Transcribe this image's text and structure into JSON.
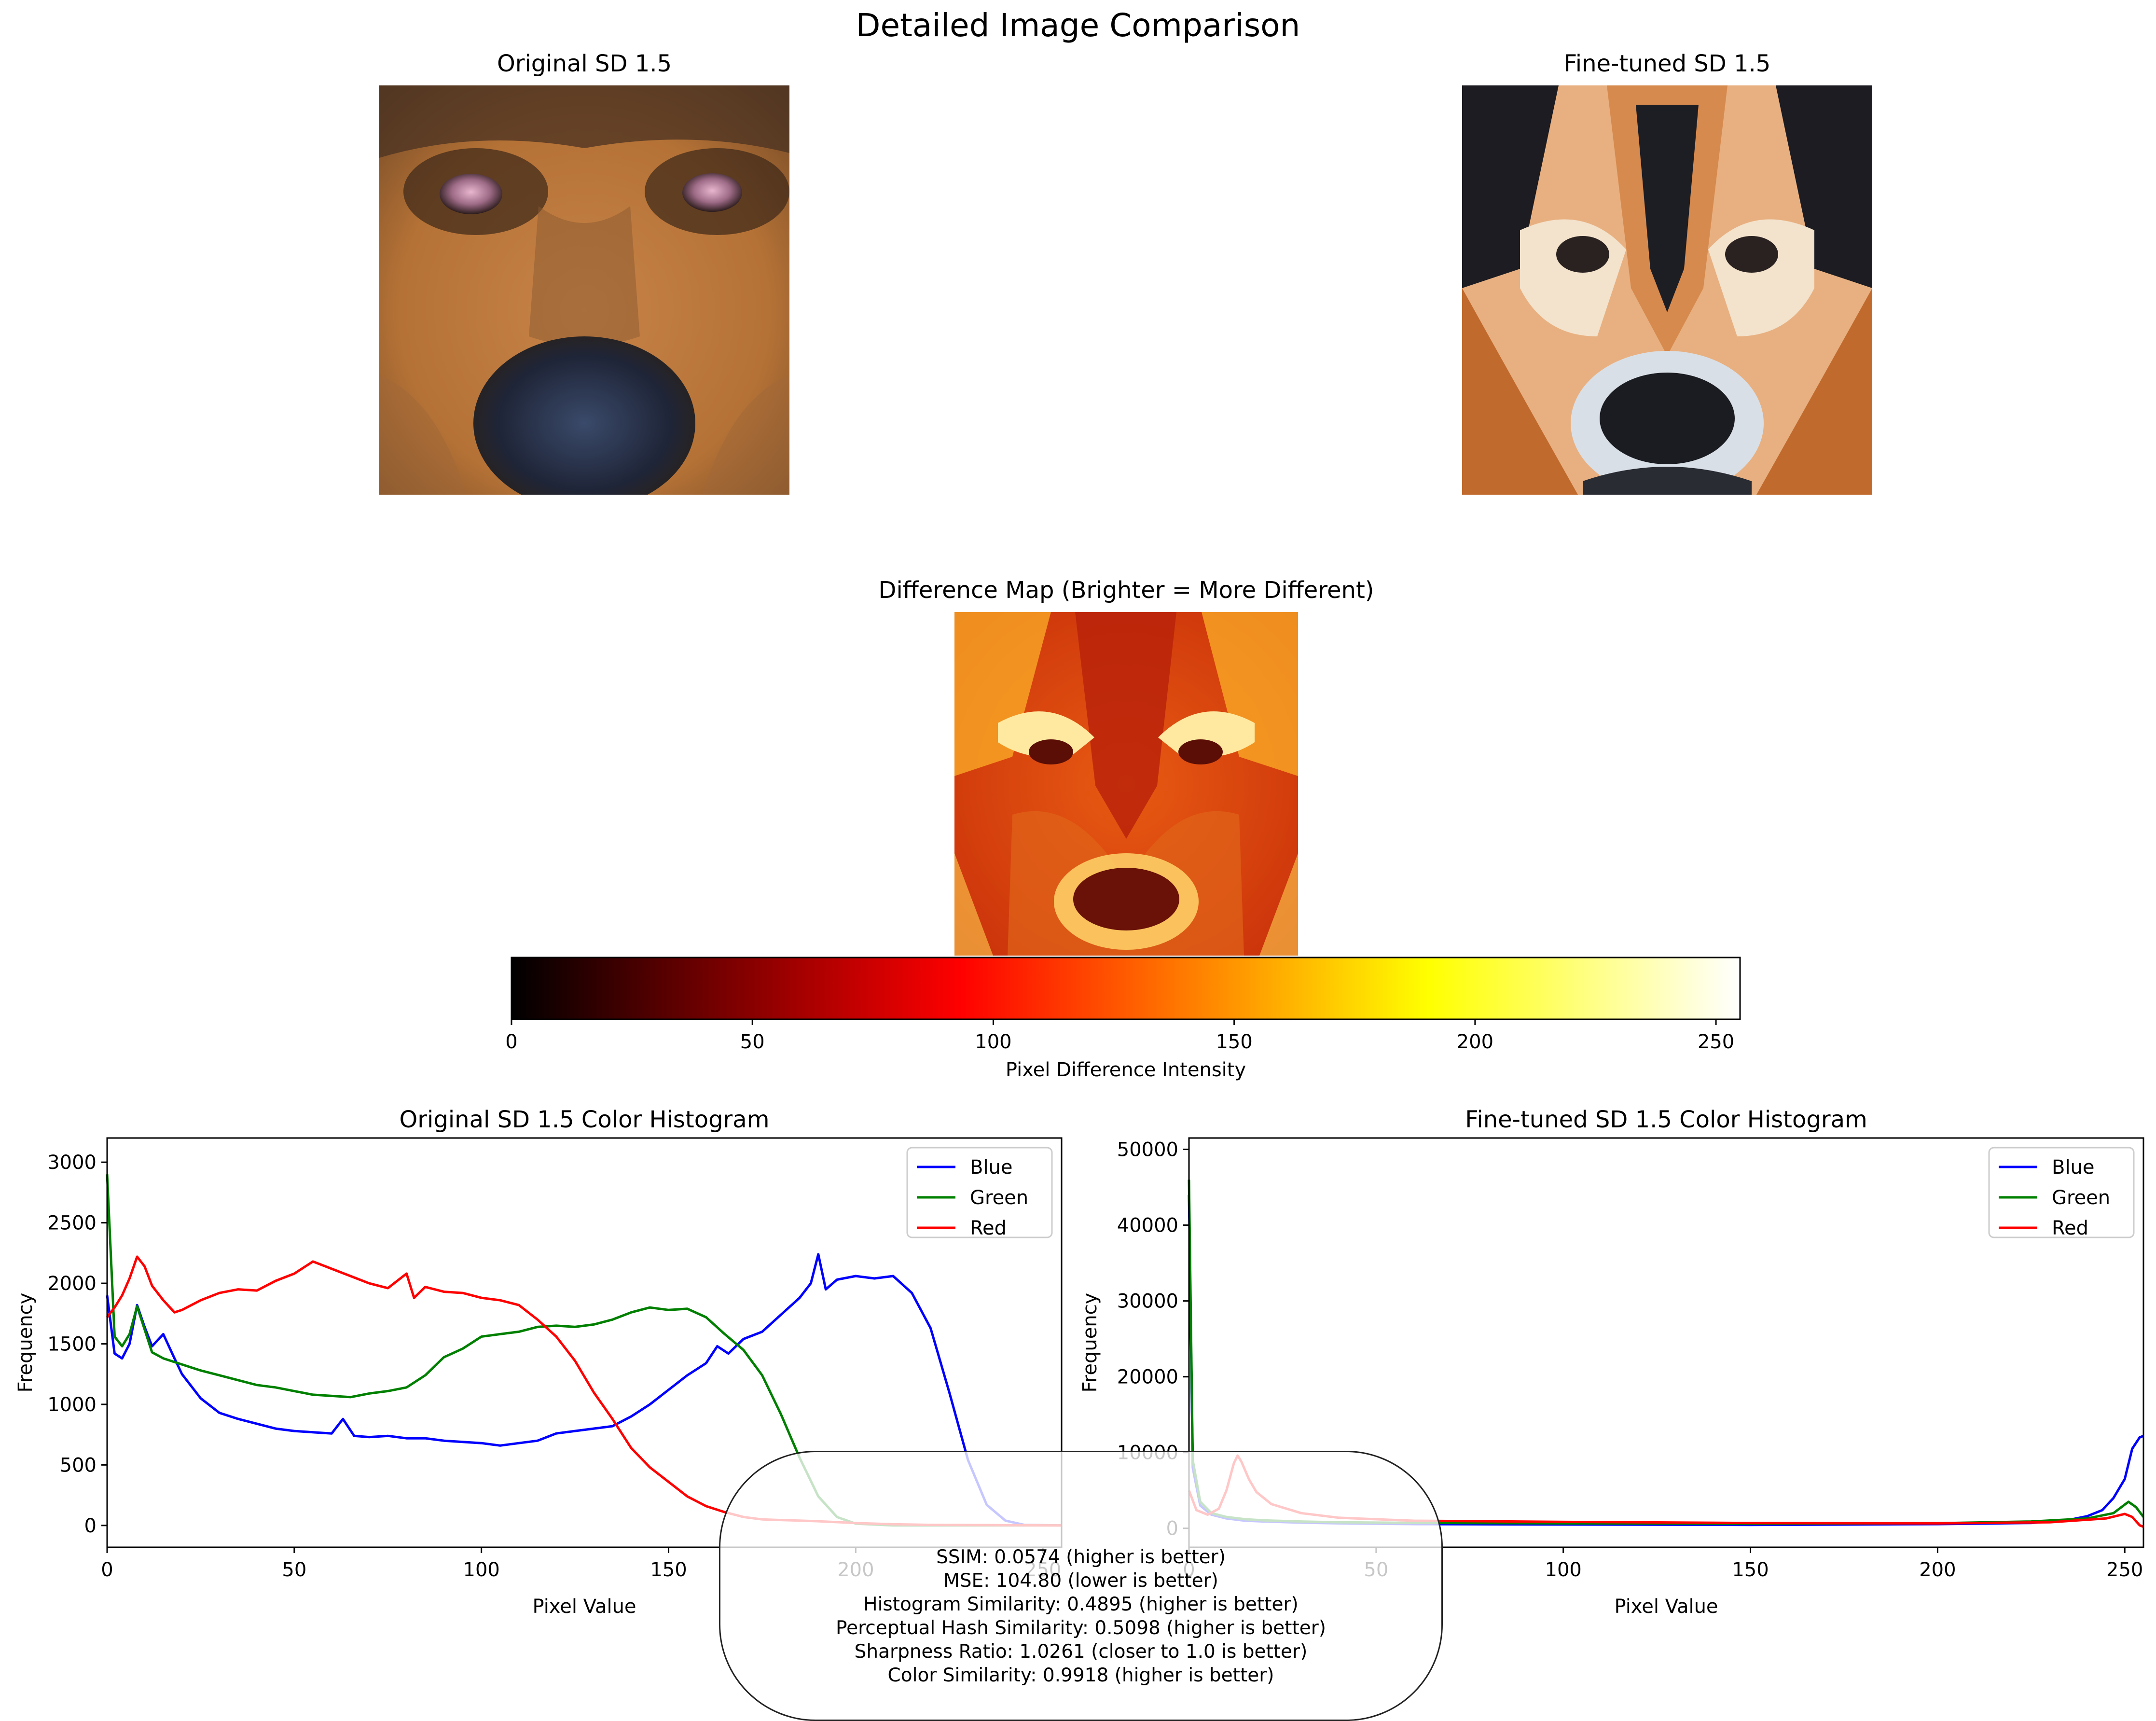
{
  "figure": {
    "title": "Detailed Image Comparison",
    "panel_original_title": "Original SD 1.5",
    "panel_finetuned_title": "Fine-tuned SD 1.5",
    "panel_diff_title": "Difference Map (Brighter = More Different)"
  },
  "images": {
    "original": {
      "depicts": "close-up of a German shepherd dog's face, photographic"
    },
    "finetuned": {
      "depicts": "stylized illustration of a dog's face with black and tan fur"
    },
    "difference": {
      "depicts": "heatmap of pixel differences in red/orange/yellow"
    }
  },
  "colorbar": {
    "label": "Pixel Difference Intensity",
    "ticks": [
      "0",
      "50",
      "100",
      "150",
      "200",
      "250"
    ],
    "range": [
      0,
      255
    ],
    "colormap": "hot",
    "colors": [
      "#000000",
      "#ff0000",
      "#ffff00",
      "#ffffff"
    ]
  },
  "metrics": [
    "SSIM: 0.0574 (higher is better)",
    "MSE: 104.80 (lower is better)",
    "Histogram Similarity: 0.4895 (higher is better)",
    "Perceptual Hash Similarity: 0.5098 (higher is better)",
    "Sharpness Ratio: 1.0261 (closer to 1.0 is better)",
    "Color Similarity: 0.9918 (higher is better)"
  ],
  "series_colors": {
    "Blue": "#0000ff",
    "Green": "#008000",
    "Red": "#ff0000"
  },
  "chart_data": [
    {
      "type": "line",
      "title": "Original SD 1.5 Color Histogram",
      "xlabel": "Pixel Value",
      "ylabel": "Frequency",
      "xlim": [
        0,
        255
      ],
      "ylim": [
        -180,
        3200
      ],
      "xticks": [
        0,
        50,
        100,
        150,
        200,
        250
      ],
      "yticks": [
        0,
        500,
        1000,
        1500,
        2000,
        2500,
        3000
      ],
      "grid": false,
      "legend": "top-right",
      "series": [
        {
          "name": "Blue",
          "points": [
            [
              0,
              1900
            ],
            [
              2,
              1420
            ],
            [
              4,
              1380
            ],
            [
              6,
              1500
            ],
            [
              8,
              1820
            ],
            [
              10,
              1640
            ],
            [
              12,
              1480
            ],
            [
              15,
              1580
            ],
            [
              18,
              1380
            ],
            [
              20,
              1250
            ],
            [
              25,
              1050
            ],
            [
              30,
              930
            ],
            [
              35,
              880
            ],
            [
              40,
              840
            ],
            [
              45,
              800
            ],
            [
              50,
              780
            ],
            [
              55,
              770
            ],
            [
              60,
              760
            ],
            [
              63,
              880
            ],
            [
              66,
              740
            ],
            [
              70,
              730
            ],
            [
              75,
              740
            ],
            [
              80,
              720
            ],
            [
              85,
              720
            ],
            [
              90,
              700
            ],
            [
              95,
              690
            ],
            [
              100,
              680
            ],
            [
              105,
              660
            ],
            [
              110,
              680
            ],
            [
              115,
              700
            ],
            [
              120,
              760
            ],
            [
              125,
              780
            ],
            [
              130,
              800
            ],
            [
              135,
              820
            ],
            [
              140,
              900
            ],
            [
              145,
              1000
            ],
            [
              150,
              1120
            ],
            [
              155,
              1240
            ],
            [
              160,
              1340
            ],
            [
              163,
              1480
            ],
            [
              166,
              1420
            ],
            [
              170,
              1540
            ],
            [
              175,
              1600
            ],
            [
              180,
              1740
            ],
            [
              185,
              1880
            ],
            [
              188,
              2000
            ],
            [
              190,
              2240
            ],
            [
              192,
              1950
            ],
            [
              195,
              2030
            ],
            [
              200,
              2060
            ],
            [
              205,
              2040
            ],
            [
              210,
              2060
            ],
            [
              215,
              1920
            ],
            [
              220,
              1630
            ],
            [
              225,
              1100
            ],
            [
              230,
              540
            ],
            [
              235,
              170
            ],
            [
              240,
              40
            ],
            [
              245,
              5
            ],
            [
              255,
              0
            ]
          ]
        },
        {
          "name": "Green",
          "points": [
            [
              0,
              2900
            ],
            [
              2,
              1560
            ],
            [
              4,
              1480
            ],
            [
              6,
              1580
            ],
            [
              8,
              1810
            ],
            [
              10,
              1620
            ],
            [
              12,
              1430
            ],
            [
              15,
              1380
            ],
            [
              20,
              1330
            ],
            [
              25,
              1280
            ],
            [
              30,
              1240
            ],
            [
              35,
              1200
            ],
            [
              40,
              1160
            ],
            [
              45,
              1140
            ],
            [
              50,
              1110
            ],
            [
              55,
              1080
            ],
            [
              60,
              1070
            ],
            [
              65,
              1060
            ],
            [
              70,
              1090
            ],
            [
              75,
              1110
            ],
            [
              80,
              1140
            ],
            [
              85,
              1240
            ],
            [
              90,
              1390
            ],
            [
              95,
              1460
            ],
            [
              100,
              1560
            ],
            [
              105,
              1580
            ],
            [
              110,
              1600
            ],
            [
              115,
              1640
            ],
            [
              120,
              1650
            ],
            [
              125,
              1640
            ],
            [
              130,
              1660
            ],
            [
              135,
              1700
            ],
            [
              140,
              1760
            ],
            [
              145,
              1800
            ],
            [
              150,
              1780
            ],
            [
              155,
              1790
            ],
            [
              160,
              1720
            ],
            [
              165,
              1580
            ],
            [
              170,
              1450
            ],
            [
              175,
              1240
            ],
            [
              180,
              920
            ],
            [
              185,
              560
            ],
            [
              190,
              240
            ],
            [
              195,
              70
            ],
            [
              200,
              15
            ],
            [
              210,
              0
            ],
            [
              255,
              0
            ]
          ]
        },
        {
          "name": "Red",
          "points": [
            [
              0,
              1720
            ],
            [
              2,
              1800
            ],
            [
              4,
              1900
            ],
            [
              6,
              2040
            ],
            [
              8,
              2220
            ],
            [
              10,
              2140
            ],
            [
              12,
              1980
            ],
            [
              15,
              1860
            ],
            [
              18,
              1760
            ],
            [
              20,
              1780
            ],
            [
              25,
              1860
            ],
            [
              30,
              1920
            ],
            [
              35,
              1950
            ],
            [
              40,
              1940
            ],
            [
              45,
              2020
            ],
            [
              50,
              2080
            ],
            [
              55,
              2180
            ],
            [
              60,
              2120
            ],
            [
              65,
              2060
            ],
            [
              70,
              2000
            ],
            [
              75,
              1960
            ],
            [
              80,
              2080
            ],
            [
              82,
              1880
            ],
            [
              85,
              1970
            ],
            [
              90,
              1930
            ],
            [
              95,
              1920
            ],
            [
              100,
              1880
            ],
            [
              105,
              1860
            ],
            [
              110,
              1820
            ],
            [
              115,
              1700
            ],
            [
              120,
              1560
            ],
            [
              125,
              1360
            ],
            [
              130,
              1100
            ],
            [
              135,
              880
            ],
            [
              140,
              640
            ],
            [
              145,
              480
            ],
            [
              150,
              360
            ],
            [
              155,
              240
            ],
            [
              160,
              160
            ],
            [
              165,
              110
            ],
            [
              170,
              70
            ],
            [
              175,
              50
            ],
            [
              180,
              45
            ],
            [
              185,
              40
            ],
            [
              190,
              35
            ],
            [
              200,
              20
            ],
            [
              210,
              10
            ],
            [
              220,
              5
            ],
            [
              255,
              0
            ]
          ]
        }
      ]
    },
    {
      "type": "line",
      "title": "Fine-tuned SD 1.5 Color Histogram",
      "xlabel": "Pixel Value",
      "ylabel": "Frequency",
      "xlim": [
        0,
        255
      ],
      "ylim": [
        -2500,
        51500
      ],
      "xticks": [
        0,
        50,
        100,
        150,
        200,
        250
      ],
      "yticks": [
        0,
        10000,
        20000,
        30000,
        40000,
        50000
      ],
      "grid": false,
      "legend": "top-right",
      "series": [
        {
          "name": "Blue",
          "points": [
            [
              0,
              44000
            ],
            [
              1,
              8000
            ],
            [
              3,
              3000
            ],
            [
              6,
              1800
            ],
            [
              10,
              1300
            ],
            [
              15,
              1000
            ],
            [
              20,
              900
            ],
            [
              30,
              750
            ],
            [
              40,
              650
            ],
            [
              60,
              550
            ],
            [
              100,
              500
            ],
            [
              150,
              450
            ],
            [
              200,
              550
            ],
            [
              225,
              700
            ],
            [
              235,
              1100
            ],
            [
              240,
              1600
            ],
            [
              244,
              2400
            ],
            [
              247,
              4000
            ],
            [
              250,
              6500
            ],
            [
              252,
              10500
            ],
            [
              254,
              12000
            ],
            [
              255,
              12200
            ]
          ]
        },
        {
          "name": "Green",
          "points": [
            [
              0,
              46000
            ],
            [
              1,
              9000
            ],
            [
              3,
              3500
            ],
            [
              6,
              2000
            ],
            [
              10,
              1500
            ],
            [
              15,
              1200
            ],
            [
              20,
              1050
            ],
            [
              30,
              900
            ],
            [
              40,
              800
            ],
            [
              60,
              720
            ],
            [
              100,
              650
            ],
            [
              150,
              600
            ],
            [
              200,
              680
            ],
            [
              225,
              900
            ],
            [
              240,
              1300
            ],
            [
              247,
              2000
            ],
            [
              251,
              3500
            ],
            [
              253,
              2800
            ],
            [
              255,
              1500
            ]
          ]
        },
        {
          "name": "Red",
          "points": [
            [
              0,
              5000
            ],
            [
              2,
              2400
            ],
            [
              5,
              1800
            ],
            [
              8,
              2600
            ],
            [
              10,
              5000
            ],
            [
              12,
              8600
            ],
            [
              13,
              9600
            ],
            [
              14,
              8800
            ],
            [
              16,
              6500
            ],
            [
              18,
              4800
            ],
            [
              22,
              3200
            ],
            [
              30,
              2000
            ],
            [
              40,
              1400
            ],
            [
              60,
              1000
            ],
            [
              100,
              850
            ],
            [
              150,
              700
            ],
            [
              200,
              650
            ],
            [
              230,
              800
            ],
            [
              245,
              1300
            ],
            [
              250,
              1900
            ],
            [
              252,
              1500
            ],
            [
              254,
              400
            ],
            [
              255,
              200
            ]
          ]
        }
      ]
    }
  ]
}
